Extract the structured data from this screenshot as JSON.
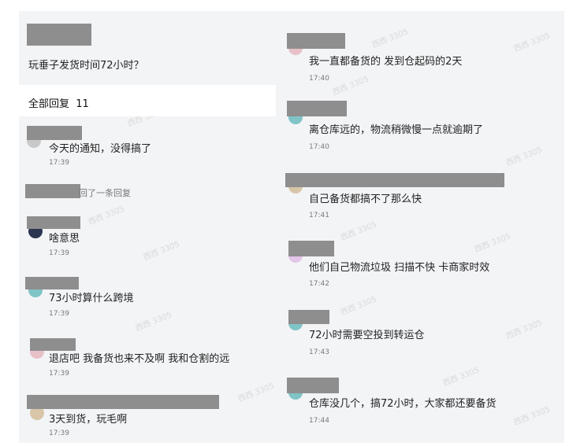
{
  "post": {
    "title": "玩垂子发货时间72小时？"
  },
  "replies_header": {
    "label": "全部回复",
    "count": "11"
  },
  "left_comments": [
    {
      "text": "今天的通知，没得搞了",
      "time": "17:39"
    },
    {
      "note": "回了一条回复"
    },
    {
      "text": "啥意思",
      "time": "17:39"
    },
    {
      "text": "73小时算什么跨境",
      "time": "17:39"
    },
    {
      "text": "退店吧 我备货也来不及啊 我和仓割的远",
      "time": "17:39"
    },
    {
      "text": "3天到货，玩毛啊",
      "time": "17:39"
    }
  ],
  "right_comments": [
    {
      "text": "我一直都备货的 发到仓起码的2天",
      "time": "17:40"
    },
    {
      "text": "离仓库远的，物流稍微慢一点就逾期了",
      "time": "17:40"
    },
    {
      "text": "自己备货都搞不了那么快",
      "time": "17:41"
    },
    {
      "text": "他们自己物流垃圾 扫描不快 卡商家时效",
      "time": "17:42"
    },
    {
      "text": "72小时需要空投到转运仓",
      "time": "17:43"
    },
    {
      "text": "仓库没几个，搞72小时，大家都还要备货",
      "time": "17:44"
    }
  ],
  "watermark_text": "西西 3305",
  "colors": {
    "panel_bg": "#f3f4f6",
    "redaction": "#8e8e8e",
    "timestamp": "#7a7a7a",
    "watermark": "#d9d9d9"
  }
}
